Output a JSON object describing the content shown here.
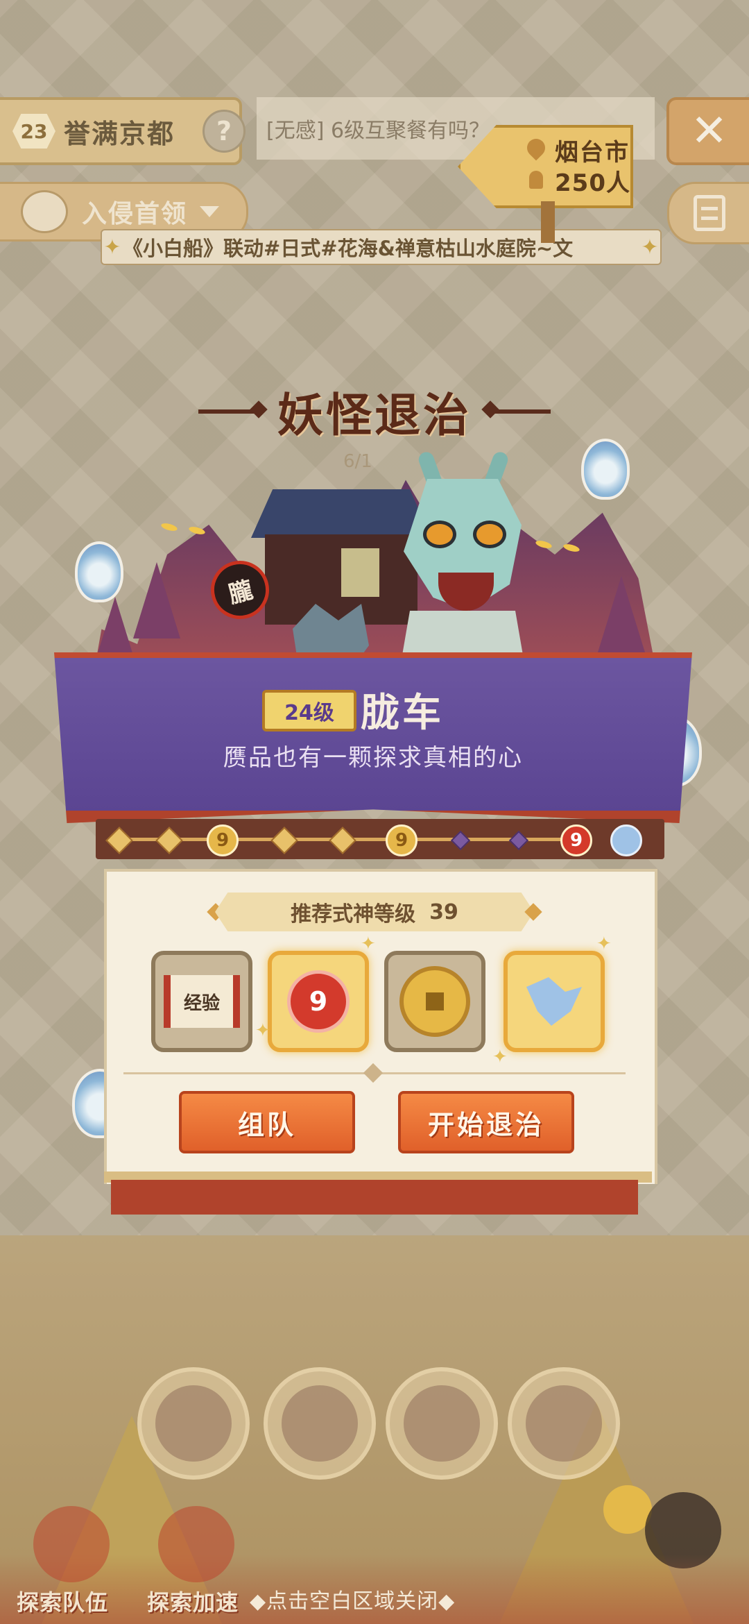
{
  "top_bar": {
    "player_level": "23",
    "server_name": "誉满京都",
    "chat_message": "[无感] 6级互聚餐有吗？"
  },
  "secondary_bar": {
    "dropdown_label": "入侵首领"
  },
  "marquee": {
    "text": "《小白船》联动#日式#花海&禅意枯山水庭院~文"
  },
  "event": {
    "title": "妖怪退治",
    "date_partial": "6/1"
  },
  "location": {
    "city": "烟台市",
    "count": "250人"
  },
  "boss": {
    "level": "24级",
    "name": "胧车",
    "lantern_glyph": "朧",
    "motto": "赝品也有一颗探求真相的心"
  },
  "recommendation": {
    "label": "推荐式神等级",
    "value": "39"
  },
  "rewards": [
    {
      "name": "经验",
      "icon": "exp-scroll-icon"
    },
    {
      "name": "",
      "icon": "magatama-icon"
    },
    {
      "name": "",
      "icon": "coin-icon"
    },
    {
      "name": "",
      "icon": "paper-bird-icon"
    }
  ],
  "actions": {
    "team": "组队",
    "start": "开始退治"
  },
  "bottom": {
    "explore_team": "探索队伍",
    "explore_boost": "探索加速",
    "close_hint": "◆点击空白区域关闭◆"
  },
  "colors": {
    "accent_orange": "#e0602a",
    "banner_purple": "#5b4592",
    "title_brown": "#5b2a18"
  }
}
